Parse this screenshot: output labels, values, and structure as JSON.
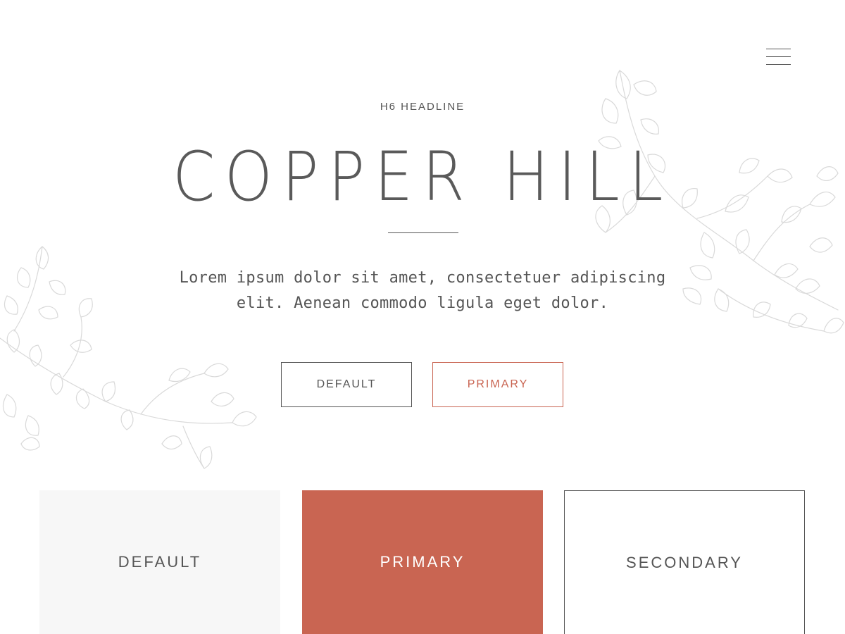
{
  "header": {
    "menu_icon": "hamburger-menu-icon"
  },
  "hero": {
    "eyebrow": "H6 HEADLINE",
    "title": "COPPER HILL",
    "lead_line_1": "Lorem ipsum dolor sit amet, consectetuer adipiscing",
    "lead_line_2": "elit. Aenean commodo ligula eget dolor."
  },
  "buttons": {
    "default_label": "DEFAULT",
    "primary_label": "PRIMARY"
  },
  "cards": [
    {
      "label": "DEFAULT",
      "style": "default"
    },
    {
      "label": "PRIMARY",
      "style": "primary"
    },
    {
      "label": "SECONDARY",
      "style": "secondary"
    }
  ],
  "colors": {
    "text": "#555555",
    "accent": "#c96552",
    "muted_bg": "#f7f7f7",
    "foliage": "#d9d9d9"
  },
  "decoration": {
    "background_art": "botanical-leaf-illustration"
  }
}
